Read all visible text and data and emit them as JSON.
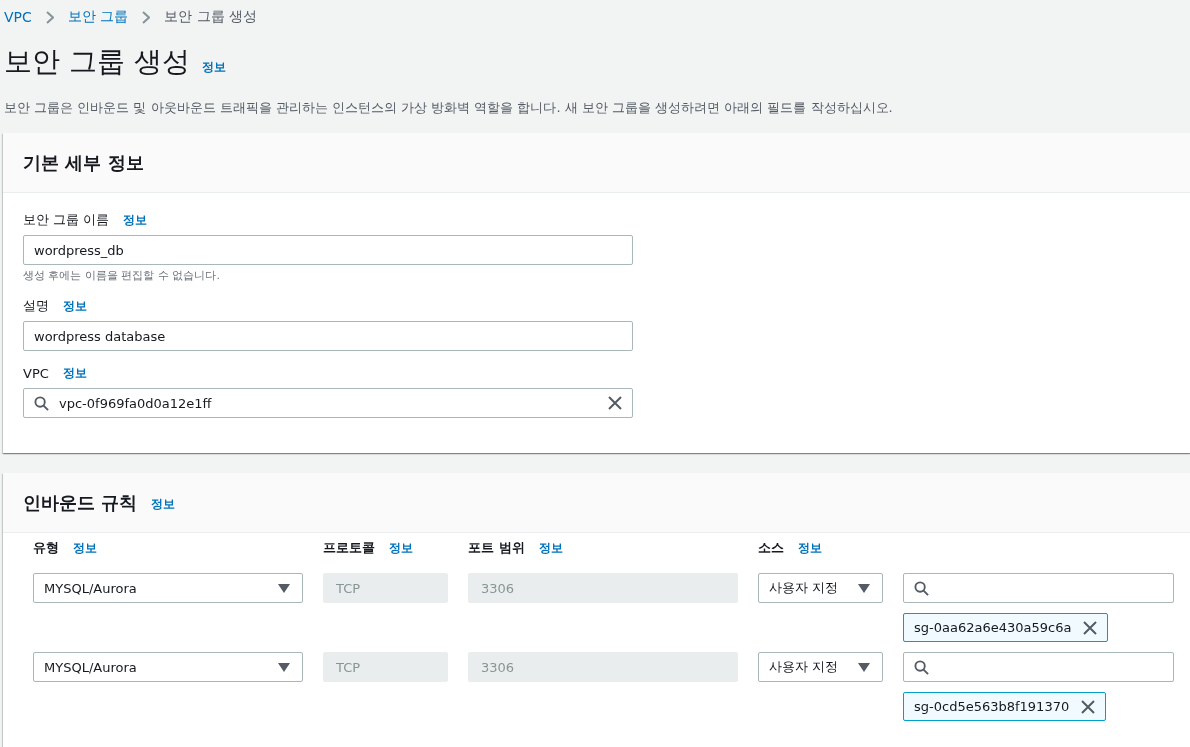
{
  "breadcrumb": [
    {
      "label": "VPC",
      "link": true
    },
    {
      "label": "보안 그룹",
      "link": true
    },
    {
      "label": "보안 그룹 생성",
      "link": false
    }
  ],
  "page": {
    "title": "보안 그룹 생성",
    "info": "정보",
    "description": "보안 그룹은 인바운드 및 아웃바운드 트래픽을 관리하는 인스턴스의 가상 방화벽 역할을 합니다. 새 보안 그룹을 생성하려면 아래의 필드를 작성하십시오."
  },
  "basic_details": {
    "heading": "기본 세부 정보",
    "fields": [
      {
        "kind": "text",
        "label": "보안 그룹 이름",
        "info": "정보",
        "value": "wordpress_db",
        "hint": "생성 후에는 이름을 편집할 수 없습니다."
      },
      {
        "kind": "text",
        "label": "설명",
        "info": "정보",
        "value": "wordpress database"
      },
      {
        "kind": "search",
        "label": "VPC",
        "info": "정보",
        "value": "vpc-0f969fa0d0a12e1ff"
      }
    ]
  },
  "inbound_rules": {
    "heading": "인바운드 규칙",
    "info": "정보",
    "columns": [
      {
        "label": "유형",
        "info": "정보"
      },
      {
        "label": "프로토콜",
        "info": "정보"
      },
      {
        "label": "포트 범위",
        "info": "정보"
      },
      {
        "label": "소스",
        "info": "정보"
      }
    ],
    "rows": [
      {
        "type": "MYSQL/Aurora",
        "protocol": {
          "value": "TCP",
          "disabled": true
        },
        "port_range": {
          "value": "3306",
          "disabled": true
        },
        "source": "사용자 지정",
        "tokens": [
          "sg-0aa62a6e430a59c6a"
        ]
      },
      {
        "type": "MYSQL/Aurora",
        "protocol": {
          "value": "TCP",
          "disabled": true
        },
        "port_range": {
          "value": "3306",
          "disabled": true
        },
        "source": "사용자 지정",
        "tokens": [
          "sg-0cd5e563b8f191370"
        ]
      }
    ]
  }
}
